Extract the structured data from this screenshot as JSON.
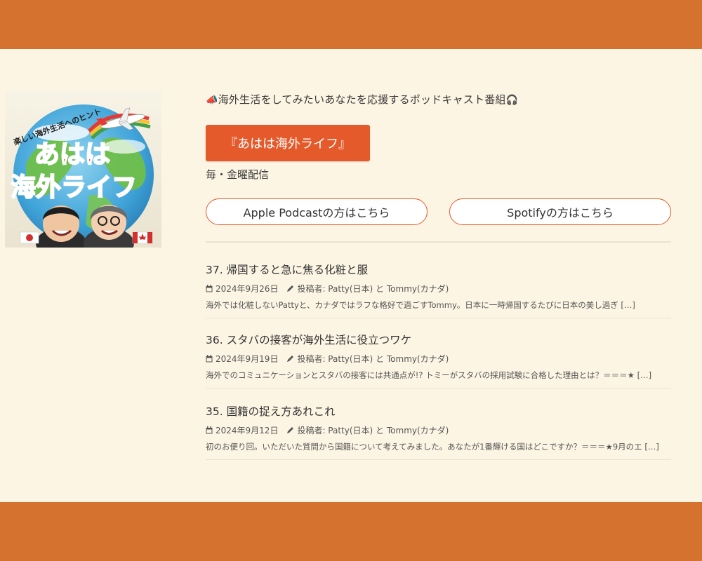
{
  "cover": {
    "arc_text": "楽しい海外生活へのヒント",
    "logo_line1": "あはは",
    "logo_line2": "海外ライフ",
    "flags": [
      "japan-flag",
      "canada-flag"
    ]
  },
  "header": {
    "tagline_prefix_icon": "📣",
    "tagline": "海外生活をしてみたいあなたを応援するポッドキャスト番組",
    "tagline_suffix_icon": "🎧",
    "title_button": "『あはは海外ライフ』",
    "schedule": "毎・金曜配信"
  },
  "links": {
    "apple": "Apple Podcastの方はこちら",
    "spotify": "Spotifyの方はこちら"
  },
  "episodes": [
    {
      "title": "37. 帰国すると急に焦る化粧と服",
      "date": "2024年9月26日",
      "author": "投稿者: Patty(日本) と Tommy(カナダ)",
      "excerpt": "海外では化粧しないPattyと、カナダではラフな格好で過ごすTommy。日本に一時帰国するたびに日本の美し過ぎ […]"
    },
    {
      "title": "36. スタバの接客が海外生活に役立つワケ",
      "date": "2024年9月19日",
      "author": "投稿者: Patty(日本) と Tommy(カナダ)",
      "excerpt": "海外でのコミュニケーションとスタバの接客には共通点が!? トミーがスタバの採用試験に合格した理由とは？＝＝＝★ […]"
    },
    {
      "title": "35. 国籍の捉え方あれこれ",
      "date": "2024年9月12日",
      "author": "投稿者: Patty(日本) と Tommy(カナダ)",
      "excerpt": "初のお便り回。いただいた質問から国籍について考えてみました。あなたが1番輝ける国はどこですか？＝＝＝★9月のエ […]"
    }
  ],
  "colors": {
    "bar": "#d67230",
    "accent": "#e55a2b",
    "background": "#fdf5e4"
  }
}
